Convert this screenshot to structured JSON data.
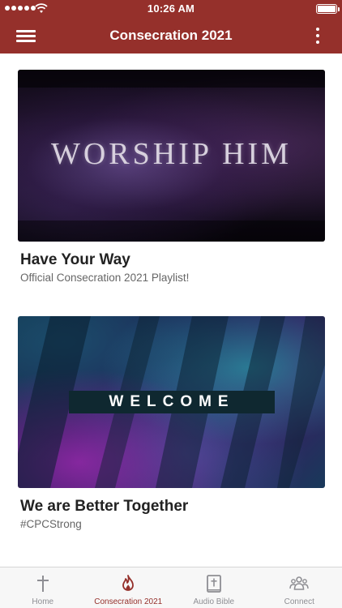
{
  "status_bar": {
    "time": "10:26 AM"
  },
  "nav": {
    "title": "Consecration 2021"
  },
  "cards": [
    {
      "image_text": "Worship Him",
      "title": "Have Your Way",
      "subtitle": "Official Consecration 2021 Playlist!"
    },
    {
      "image_text": "WELCOME",
      "title": "We are Better Together",
      "subtitle": "#CPCStrong"
    }
  ],
  "tabs": [
    {
      "label": "Home",
      "icon": "cross-icon",
      "active": false
    },
    {
      "label": "Consecration 2021",
      "icon": "flame-icon",
      "active": true
    },
    {
      "label": "Audio Bible",
      "icon": "bible-icon",
      "active": false
    },
    {
      "label": "Connect",
      "icon": "people-icon",
      "active": false
    }
  ],
  "colors": {
    "brand": "#95302b",
    "tab_inactive": "#8e8e93",
    "tab_bar_bg": "#f7f7f7"
  }
}
